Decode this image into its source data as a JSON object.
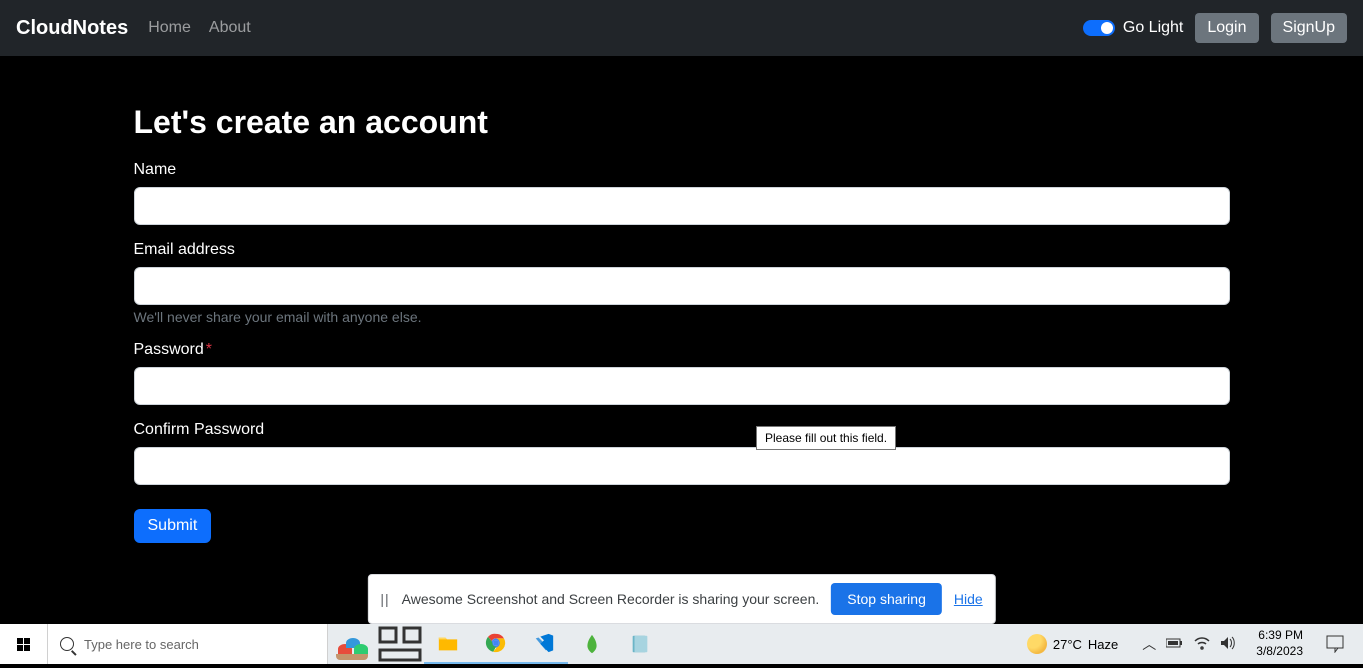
{
  "navbar": {
    "brand": "CloudNotes",
    "home": "Home",
    "about": "About",
    "toggle_label": "Go Light",
    "login": "Login",
    "signup": "SignUp"
  },
  "form": {
    "title": "Let's create an account",
    "name_label": "Name",
    "email_label": "Email address",
    "email_help": "We'll never share your email with anyone else.",
    "password_label": "Password",
    "confirm_label": "Confirm Password",
    "submit": "Submit"
  },
  "tooltip": {
    "text": "Please fill out this field."
  },
  "share_bar": {
    "text": "Awesome Screenshot and Screen Recorder is sharing your screen.",
    "stop": "Stop sharing",
    "hide": "Hide"
  },
  "taskbar": {
    "search_placeholder": "Type here to search",
    "weather_temp": "27°C",
    "weather_desc": "Haze",
    "time": "6:39 PM",
    "date": "3/8/2023"
  }
}
